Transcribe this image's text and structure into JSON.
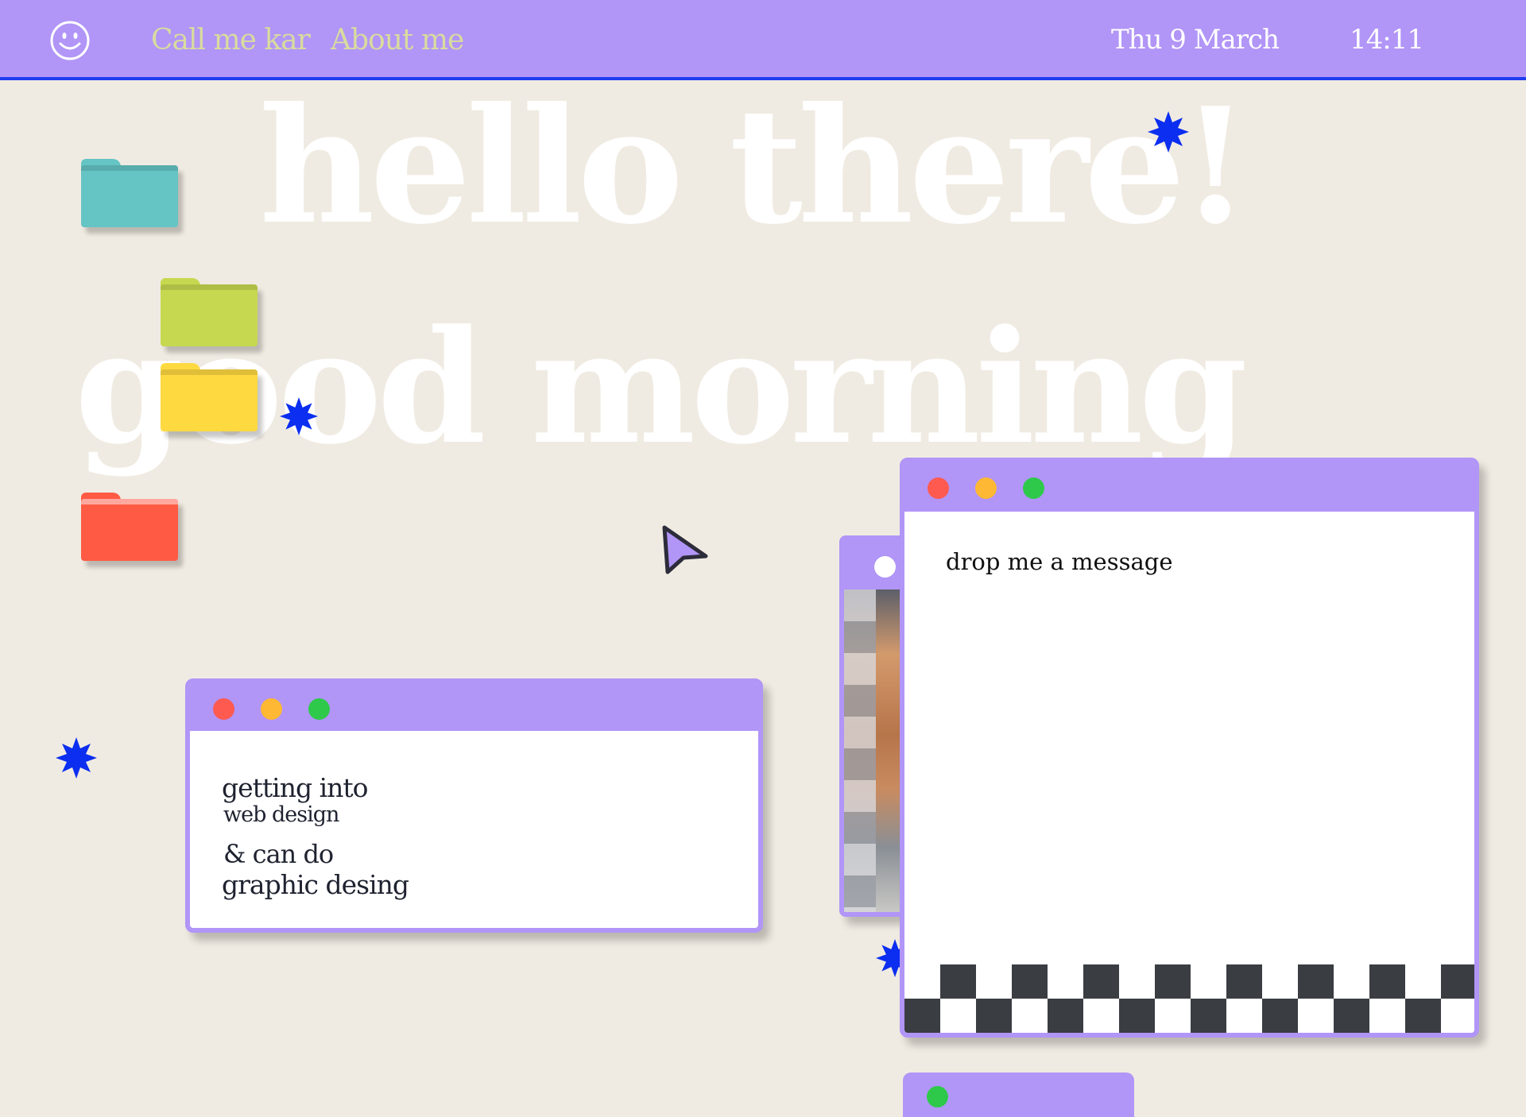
{
  "topbar": {
    "logo_icon": "smiley-icon",
    "nav": [
      {
        "label": "Call me kar"
      },
      {
        "label": "About me"
      }
    ],
    "date": "Thu 9 March",
    "time": "14:11"
  },
  "hero": {
    "line1": "hello there!",
    "line2": "good morning"
  },
  "desktop": {
    "folders": [
      {
        "color": "#65c4c4",
        "icon": "folder-icon"
      },
      {
        "color": "#c6d84f",
        "icon": "folder-icon"
      },
      {
        "color": "#ffd940",
        "icon": "folder-icon"
      },
      {
        "color": "#ff5a44",
        "icon": "folder-icon"
      }
    ]
  },
  "about_window": {
    "lines": [
      "getting into",
      "web design",
      "& can do",
      "graphic desing"
    ]
  },
  "message_window": {
    "title": "drop me a message"
  },
  "colors": {
    "accent": "#b195f7",
    "border_blue": "#1e3cf0",
    "sparkle": "#0b2ef0",
    "background": "#f0ebe2",
    "dot_red": "#ff5a50",
    "dot_yellow": "#ffb833",
    "dot_green": "#2ec94a"
  }
}
